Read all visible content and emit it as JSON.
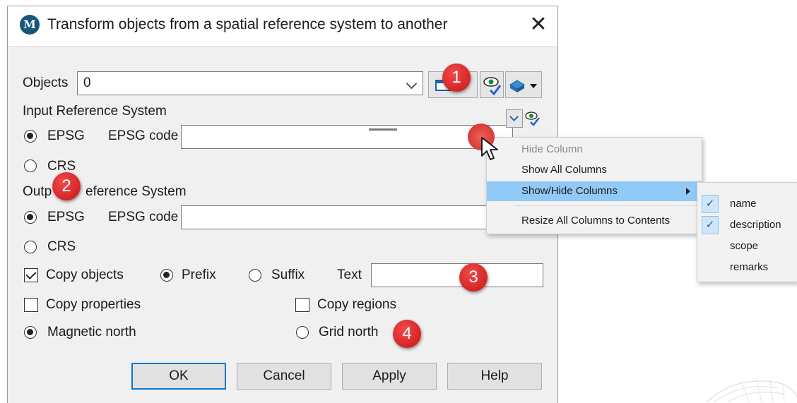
{
  "dialog": {
    "title": "Transform objects from a spatial reference system to another",
    "app_icon_letter": "M",
    "close_glyph": "✕"
  },
  "objects": {
    "label": "Objects",
    "value": "0"
  },
  "input_ref": {
    "heading": "Input Reference System",
    "epsg_label": "EPSG",
    "epsg_code_label": "EPSG code",
    "epsg_code_value": "",
    "crs_label": "CRS",
    "epsg_selected": true
  },
  "output_ref": {
    "heading_left": "Outp",
    "heading_right": "eference System",
    "epsg_label": "EPSG",
    "epsg_code_label": "EPSG code",
    "epsg_code_value": "",
    "crs_label": "CRS",
    "epsg_selected": true
  },
  "options": {
    "copy_objects_label": "Copy objects",
    "copy_objects_checked": true,
    "prefix_label": "Prefix",
    "prefix_selected": true,
    "suffix_label": "Suffix",
    "text_label": "Text",
    "text_value": "",
    "copy_properties_label": "Copy properties",
    "copy_properties_checked": false,
    "copy_regions_label": "Copy regions",
    "copy_regions_checked": false,
    "magnetic_north_label": "Magnetic north",
    "magnetic_north_selected": true,
    "grid_north_label": "Grid north"
  },
  "buttons": {
    "ok": "OK",
    "cancel": "Cancel",
    "apply": "Apply",
    "help": "Help"
  },
  "badges": [
    "1",
    "2",
    "3",
    "4"
  ],
  "context_menu": {
    "items": [
      {
        "label": "Hide Column",
        "disabled": true
      },
      {
        "label": "Show All Columns"
      },
      {
        "label": "Show/Hide Columns",
        "highlighted": true,
        "has_submenu": true
      },
      {
        "label": "Resize All Columns to Contents"
      }
    ]
  },
  "columns_submenu": {
    "items": [
      {
        "label": "name",
        "checked": true
      },
      {
        "label": "description",
        "checked": true
      },
      {
        "label": "scope",
        "checked": false
      },
      {
        "label": "remarks",
        "checked": false
      }
    ],
    "check_glyph": "✓"
  },
  "colors": {
    "badge_red": "#d42020",
    "menu_highlight": "#91c9f7",
    "default_button_border": "#0078d7",
    "app_icon": "#16567a"
  },
  "icons": [
    "app-logo-icon",
    "close-icon",
    "chevron-down-icon",
    "select-on-view-icon",
    "eye-check-icon",
    "layer-icon",
    "dropdown-arrow-icon",
    "mouse-cursor-icon",
    "submenu-arrow-icon",
    "checkmark-icon"
  ]
}
